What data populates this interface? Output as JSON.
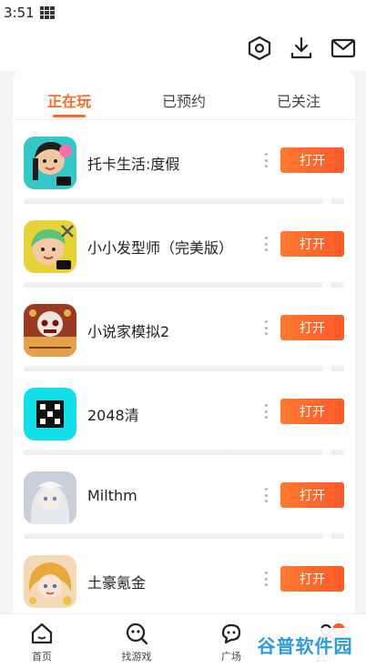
{
  "status_bar": {
    "time": "3:51"
  },
  "top_bar": {
    "icons": [
      "settings-hexagon-icon",
      "download-icon",
      "mail-icon"
    ]
  },
  "tabs": [
    {
      "label": "正在玩",
      "active": true
    },
    {
      "label": "已预约",
      "active": false
    },
    {
      "label": "已关注",
      "active": false
    }
  ],
  "games": [
    {
      "name": "托卡生活:度假",
      "button": "打开",
      "icon": "toca-life-vacation-icon"
    },
    {
      "name": "小小发型师（完美版）",
      "button": "打开",
      "icon": "hair-stylist-icon"
    },
    {
      "name": "小说家模拟2",
      "button": "打开",
      "icon": "novelist-simulator-icon"
    },
    {
      "name": "2048清",
      "button": "打开",
      "icon": "2048-icon"
    },
    {
      "name": "Milthm",
      "button": "打开",
      "icon": "milthm-icon"
    },
    {
      "name": "土豪氪金",
      "button": "打开",
      "icon": "tuhao-kejin-icon"
    }
  ],
  "bottom_nav": [
    {
      "label": "首页",
      "icon": "home-icon"
    },
    {
      "label": "找游戏",
      "icon": "find-game-icon"
    },
    {
      "label": "广场",
      "icon": "square-chat-icon"
    },
    {
      "label": "我的",
      "icon": "profile-icon"
    }
  ],
  "watermark": "谷普软件园",
  "colors": {
    "accent": "#ff6a2a",
    "button_gradient_start": "#ff7a32",
    "button_gradient_end": "#ff5a2a"
  }
}
